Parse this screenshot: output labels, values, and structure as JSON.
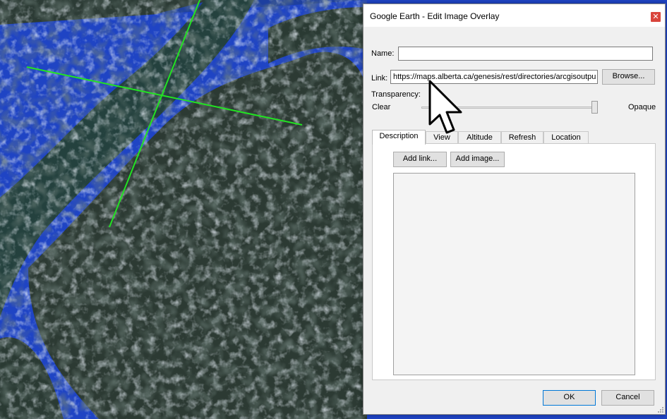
{
  "dialog": {
    "title": "Google Earth - Edit Image Overlay",
    "close_symbol": "✕",
    "name_label": "Name:",
    "name_value": "",
    "link_label": "Link:",
    "link_value": "https://maps.alberta.ca/genesis/rest/directories/arcgisoutpu",
    "browse_label": "Browse...",
    "transparency_label": "Transparency:",
    "clear_label": "Clear",
    "opaque_label": "Opaque",
    "transparency_level_percent": 100,
    "tabs": [
      {
        "label": "Description",
        "active": true
      },
      {
        "label": "View",
        "active": false
      },
      {
        "label": "Altitude",
        "active": false
      },
      {
        "label": "Refresh",
        "active": false
      },
      {
        "label": "Location",
        "active": false
      }
    ],
    "add_link_label": "Add link...",
    "add_image_label": "Add image...",
    "description_value": "",
    "ok_label": "OK",
    "cancel_label": "Cancel"
  },
  "map": {
    "water_color": "#1f44c4",
    "land_color": "#2a3a32",
    "crosshair_color": "#22e322",
    "cursor_icon": "arrow-cursor-icon"
  }
}
